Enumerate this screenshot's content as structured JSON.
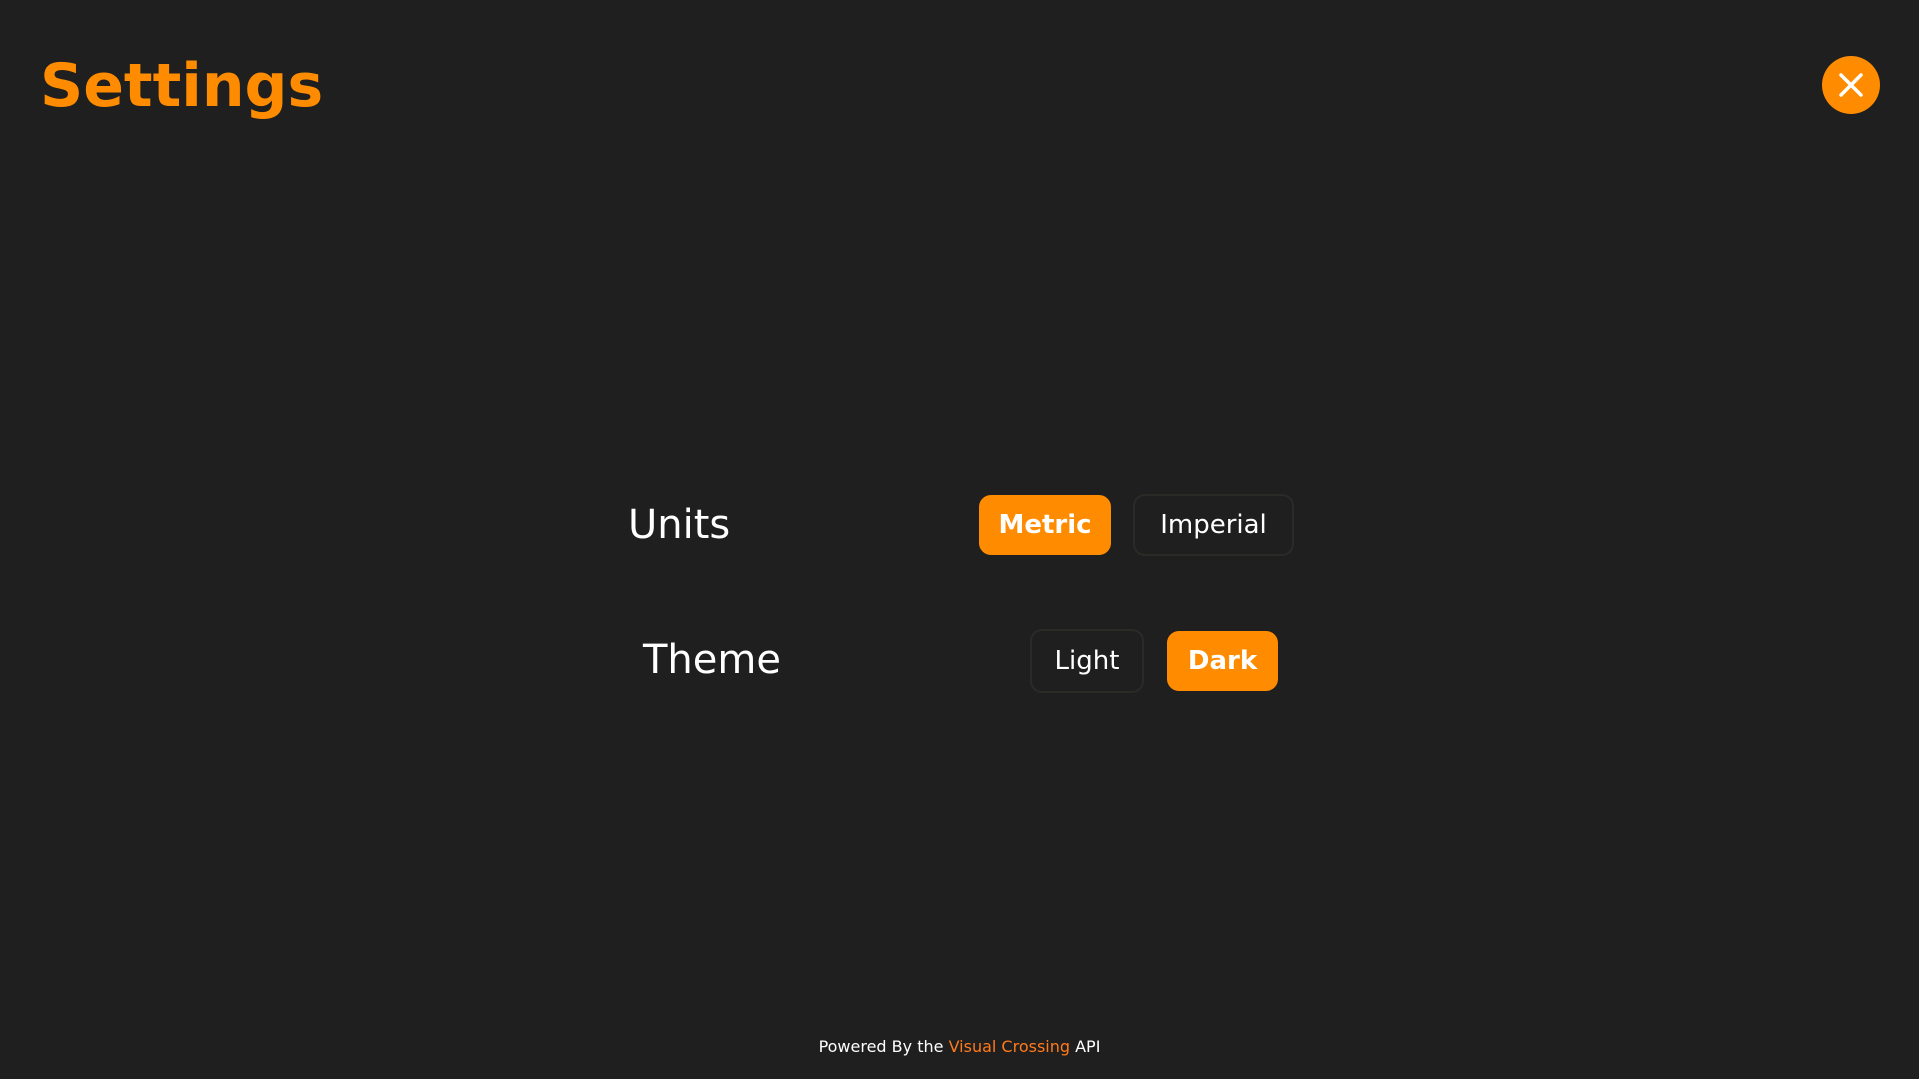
{
  "header": {
    "title": "Settings",
    "close_icon": "close-icon"
  },
  "settings": {
    "units": {
      "label": "Units",
      "options": [
        "Metric",
        "Imperial"
      ],
      "selected": "Metric"
    },
    "theme": {
      "label": "Theme",
      "options": [
        "Light",
        "Dark"
      ],
      "selected": "Dark"
    }
  },
  "footer": {
    "prefix": "Powered By the",
    "link_text": "Visual Crossing",
    "suffix": "API"
  },
  "colors": {
    "background": "#1f1f1f",
    "accent": "#ff8c00",
    "text": "#ffffff"
  }
}
